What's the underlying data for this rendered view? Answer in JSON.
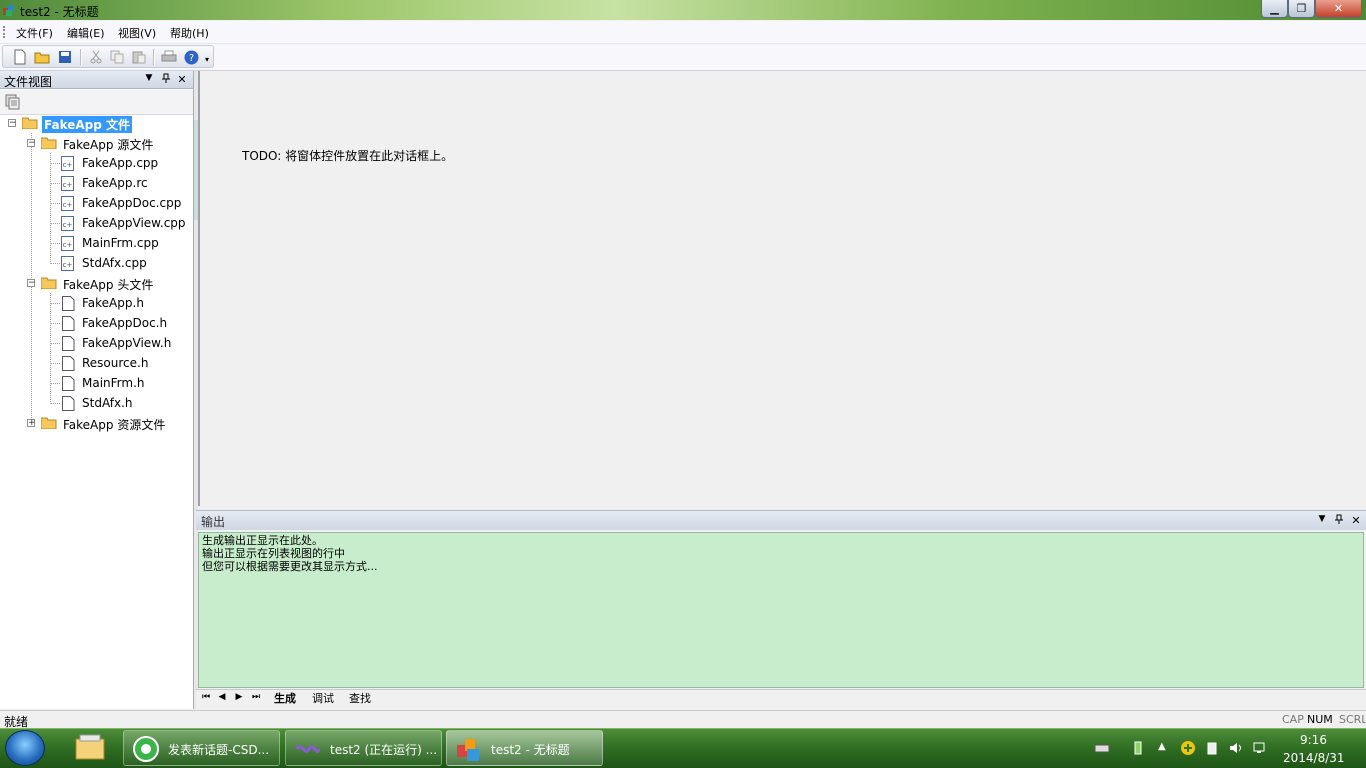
{
  "window": {
    "title": "test2 - 无标题",
    "min_label": "▁",
    "max_label": "❐",
    "close_label": "✕"
  },
  "menu": {
    "file": "文件(F)",
    "edit": "编辑(E)",
    "view": "视图(V)",
    "help": "帮助(H)"
  },
  "toolbar": {
    "icons": [
      "new-icon",
      "open-icon",
      "save-icon",
      "cut-icon",
      "copy-icon",
      "paste-icon",
      "print-icon",
      "help-icon"
    ]
  },
  "file_view": {
    "title": "文件视图",
    "dropdown": "▼",
    "pin": "ᆓ",
    "close": "✕",
    "tree": {
      "root": "FakeApp 文件",
      "source_folder": "FakeApp 源文件",
      "source_files": [
        "FakeApp.cpp",
        "FakeApp.rc",
        "FakeAppDoc.cpp",
        "FakeAppView.cpp",
        "MainFrm.cpp",
        "StdAfx.cpp"
      ],
      "header_folder": "FakeApp 头文件",
      "header_files": [
        "FakeApp.h",
        "FakeAppDoc.h",
        "FakeAppView.h",
        "Resource.h",
        "MainFrm.h",
        "StdAfx.h"
      ],
      "resource_folder": "FakeApp 资源文件"
    }
  },
  "main": {
    "todo": "TODO: 将窗体控件放置在此对话框上。"
  },
  "output": {
    "title": "输出",
    "lines": [
      "生成输出正显示在此处。",
      "输出正显示在列表视图的行中",
      "但您可以根据需要更改其显示方式..."
    ],
    "tabs": [
      "生成",
      "调试",
      "查找"
    ],
    "nav": [
      "⏮",
      "◀",
      "▶",
      "⏭"
    ]
  },
  "status": {
    "text": "就绪",
    "cap": "CAP",
    "num": "NUM",
    "scrl": "SCRL"
  },
  "taskbar": {
    "items": [
      "发表新话题-CSD...",
      "test2 (正在运行) ...",
      "test2 - 无标题"
    ],
    "time": "9:16",
    "date": "2014/8/31"
  },
  "colors": {
    "selection": "#3399ff",
    "output_bg": "#c8edcc",
    "taskbar": "#2f6d22"
  }
}
